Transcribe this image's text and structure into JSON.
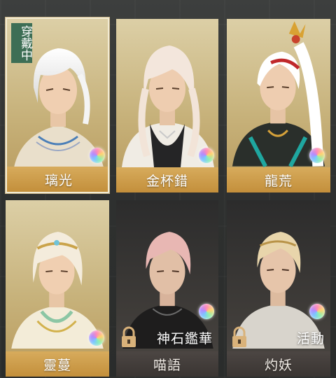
{
  "outfits": [
    {
      "id": "liuguang",
      "name": "璃光",
      "wearing_badge": "穿戴中",
      "state": "selected"
    },
    {
      "id": "jinbeicuo",
      "name": "金杯錯",
      "state": "owned"
    },
    {
      "id": "longhuang",
      "name": "龍荒",
      "state": "owned"
    },
    {
      "id": "lingman",
      "name": "靈蔓",
      "state": "owned"
    },
    {
      "id": "miaoyu",
      "name": "喵語",
      "state": "locked",
      "source_tag": "神石鑑華"
    },
    {
      "id": "zhuoyao",
      "name": "灼妖",
      "state": "locked",
      "source_tag": "活動"
    }
  ],
  "colors": {
    "owned_label": "#c99a48",
    "locked_label": "#443f3c",
    "wearing_badge": "#3d6e55"
  },
  "icons": {
    "rarity": "rainbow-orb-icon",
    "locked": "lock-icon"
  }
}
